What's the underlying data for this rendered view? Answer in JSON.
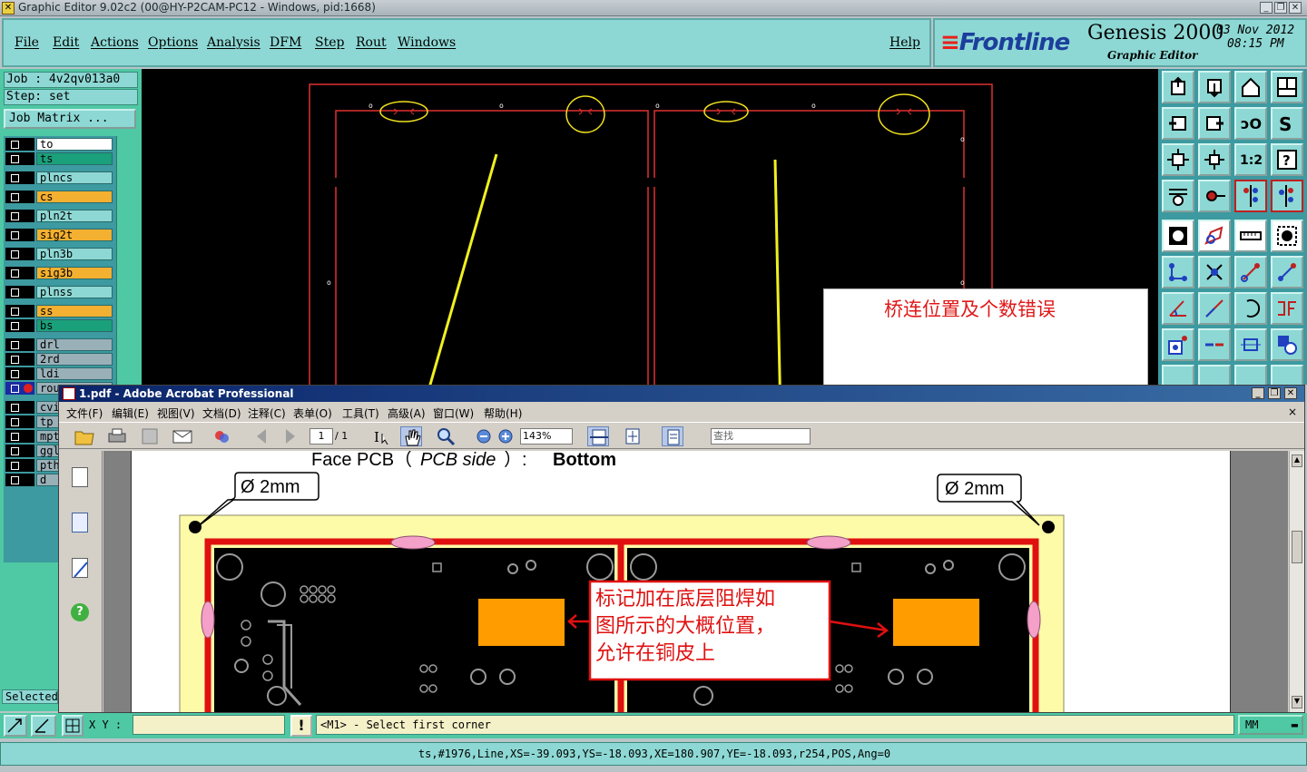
{
  "window": {
    "title": "Graphic Editor 9.02c2 (00@HY-P2CAM-PC12 - Windows, pid:1668)"
  },
  "menu": {
    "items": [
      "File",
      "Edit",
      "Actions",
      "Options",
      "Analysis",
      "DFM",
      "Step",
      "Rout",
      "Windows"
    ],
    "help": "Help"
  },
  "brand": {
    "logo": "Frontline",
    "product": "Genesis 2000",
    "subtitle": "Graphic Editor",
    "date": "03 Nov 2012",
    "time": "08:15 PM"
  },
  "job": {
    "job_label": "Job : 4v2qv013a0",
    "step_label": "Step: set",
    "matrix_button": "Job Matrix ..."
  },
  "layers": [
    {
      "name": "to",
      "color": "#ffffff"
    },
    {
      "name": "ts",
      "color": "#1aa07a"
    },
    {
      "name": "plncs",
      "color": "#8dd8d4"
    },
    {
      "name": "cs",
      "color": "#f4b030"
    },
    {
      "name": "pln2t",
      "color": "#8dd8d4"
    },
    {
      "name": "sig2t",
      "color": "#f4b030"
    },
    {
      "name": "pln3b",
      "color": "#8dd8d4"
    },
    {
      "name": "sig3b",
      "color": "#f4b030"
    },
    {
      "name": "plnss",
      "color": "#8dd8d4"
    },
    {
      "name": "ss",
      "color": "#f4b030"
    },
    {
      "name": "bs",
      "color": "#1aa07a"
    },
    {
      "name": "drl",
      "color": "#9ab0b8"
    },
    {
      "name": "2rd",
      "color": "#9ab0b8"
    },
    {
      "name": "ldi",
      "color": "#9ab0b8"
    },
    {
      "name": "rou",
      "color": "#9ab0b8"
    },
    {
      "name": "cvi",
      "color": "#9ab0b8"
    },
    {
      "name": "tp",
      "color": "#9ab0b8"
    },
    {
      "name": "mpt",
      "color": "#9ab0b8"
    },
    {
      "name": "ggl",
      "color": "#9ab0b8"
    },
    {
      "name": "pth",
      "color": "#9ab0b8"
    },
    {
      "name": "d",
      "color": "#9ab0b8"
    }
  ],
  "selected_label": "Selected",
  "annotation": {
    "text": "桥连位置及个数错误"
  },
  "acrobat": {
    "title": "1.pdf - Adobe Acrobat Professional",
    "menu": [
      "文件(F)",
      "编辑(E)",
      "视图(V)",
      "文档(D)",
      "注释(C)",
      "表单(O)",
      "工具(T)",
      "高级(A)",
      "窗口(W)",
      "帮助(H)"
    ],
    "page_current": "1",
    "page_total": "/ 1",
    "zoom": "143%",
    "find_placeholder": "查找",
    "close_x": "×"
  },
  "pdf_page": {
    "face_label": "Face PCB（",
    "face_italic": "PCB side",
    "face_after": "）:",
    "face_value": "Bottom",
    "callout_left": "Ø 2mm",
    "callout_right": "Ø 2mm",
    "note": "标记加在底层阻焊如图所示的大概位置，允许在铜皮上",
    "note_line1": "标记加在底层阻焊如",
    "note_line2": "图所示的大概位置，",
    "note_line3": "允许在铜皮上"
  },
  "command": {
    "xy_label": "X Y :",
    "prompt": "<M1> - Select first corner",
    "units": "MM",
    "exclamation": "!"
  },
  "status": {
    "text": "ts,#1976,Line,XS=-39.093,YS=-18.093,XE=180.907,YE=-18.093,r254,POS,Ang=0"
  },
  "colors": {
    "teal": "#8dd8d4",
    "green": "#4fc8a4",
    "profile_red": "#e03030",
    "marker_yellow": "#f0e020",
    "annot_red": "#e01818"
  }
}
